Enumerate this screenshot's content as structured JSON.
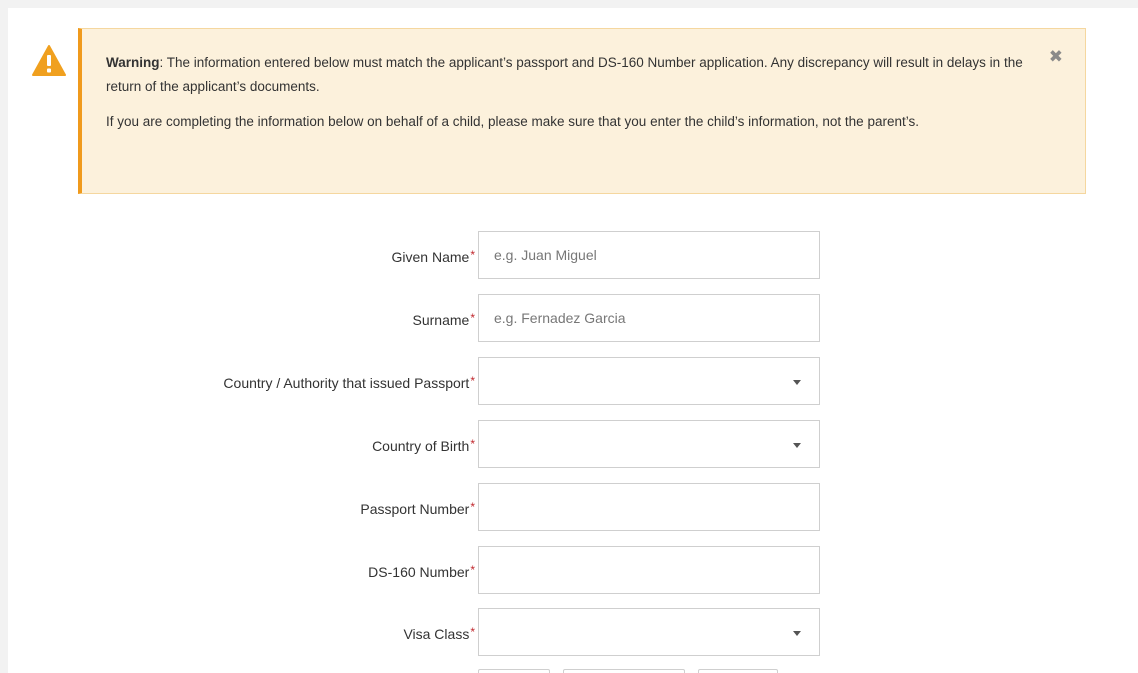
{
  "alert": {
    "icon": "warning-triangle-icon",
    "close_icon": "close-icon",
    "close_glyph": "✖",
    "warning_label": "Warning",
    "warning_text": ": The information entered below must match the applicant’s passport and DS-160 Number application. Any discrepancy will result in delays in the return of the applicant’s documents.",
    "child_text": "If you are completing the information below on behalf of a child, please make sure that you enter the child’s information, not the parent’s."
  },
  "colors": {
    "alert_background": "#fcf1dc",
    "alert_accent": "#f09a1c",
    "required_marker": "#c0282d"
  },
  "form": {
    "required_marker": "*",
    "given_name": {
      "label": "Given Name",
      "placeholder": "e.g. Juan Miguel",
      "value": ""
    },
    "surname": {
      "label": "Surname",
      "placeholder": "e.g. Fernadez Garcia",
      "value": ""
    },
    "passport_country": {
      "label": "Country / Authority that issued Passport",
      "selected": ""
    },
    "birth_country": {
      "label": "Country of Birth",
      "selected": ""
    },
    "passport_number": {
      "label": "Passport Number",
      "value": ""
    },
    "ds160_number": {
      "label": "DS-160 Number",
      "value": ""
    },
    "visa_class": {
      "label": "Visa Class",
      "selected": ""
    }
  }
}
